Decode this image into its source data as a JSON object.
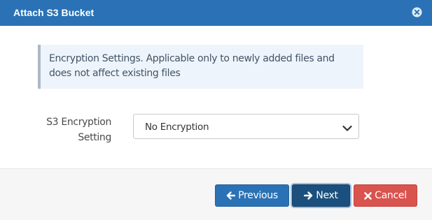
{
  "dialog": {
    "title": "Attach S3 Bucket",
    "close_icon": "close-circle-icon"
  },
  "notice": {
    "text": "Encryption Settings. Applicable only to newly added files and does not affect existing files"
  },
  "encryption": {
    "label": "S3 Encryption Setting",
    "selected": "No Encryption",
    "dropdown_icon": "chevron-down-icon"
  },
  "footer": {
    "previous_label": "Previous",
    "previous_icon": "arrow-left-icon",
    "next_label": "Next",
    "next_icon": "arrow-right-icon",
    "cancel_label": "Cancel",
    "cancel_icon": "times-icon"
  },
  "colors": {
    "header_bg": "#2a72b5",
    "primary": "#2a72b5",
    "next_active": "#1b4f7e",
    "cancel": "#d9534f",
    "notice_bg": "#eef4fb",
    "footer_bg": "#f6f6f6"
  }
}
